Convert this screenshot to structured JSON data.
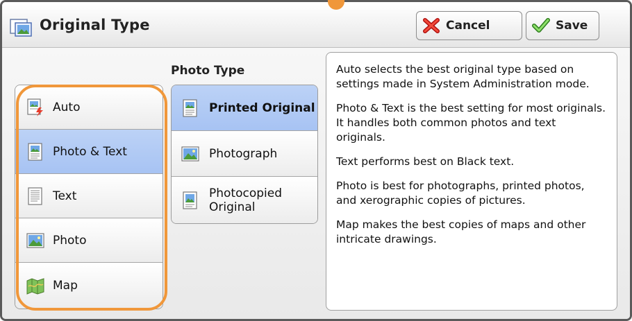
{
  "header": {
    "title": "Original Type",
    "cancel_label": "Cancel",
    "save_label": "Save"
  },
  "original_types": [
    {
      "label": "Auto",
      "icon": "auto-document-icon",
      "selected": false
    },
    {
      "label": "Photo & Text",
      "icon": "photo-text-document-icon",
      "selected": true
    },
    {
      "label": "Text",
      "icon": "text-document-icon",
      "selected": false
    },
    {
      "label": "Photo",
      "icon": "photo-icon",
      "selected": false
    },
    {
      "label": "Map",
      "icon": "map-icon",
      "selected": false
    }
  ],
  "photo_type": {
    "heading": "Photo Type",
    "items": [
      {
        "label": "Printed Original",
        "icon": "printed-original-icon",
        "selected": true
      },
      {
        "label": "Photograph",
        "icon": "photograph-icon",
        "selected": false
      },
      {
        "label": "Photocopied Original",
        "icon": "photocopied-original-icon",
        "selected": false
      }
    ]
  },
  "description": [
    "Auto selects the best original type based on settings made in System Administration mode.",
    "Photo & Text is the best setting for most originals.  It handles both common photos and text originals.",
    "Text performs best on Black text.",
    "Photo is best for photographs, printed photos, and xerographic copies of pictures.",
    "Map makes the best copies of maps and other intricate drawings."
  ],
  "colors": {
    "selected_bg": "#a7c3f3",
    "highlight_outline": "#f0973a"
  }
}
